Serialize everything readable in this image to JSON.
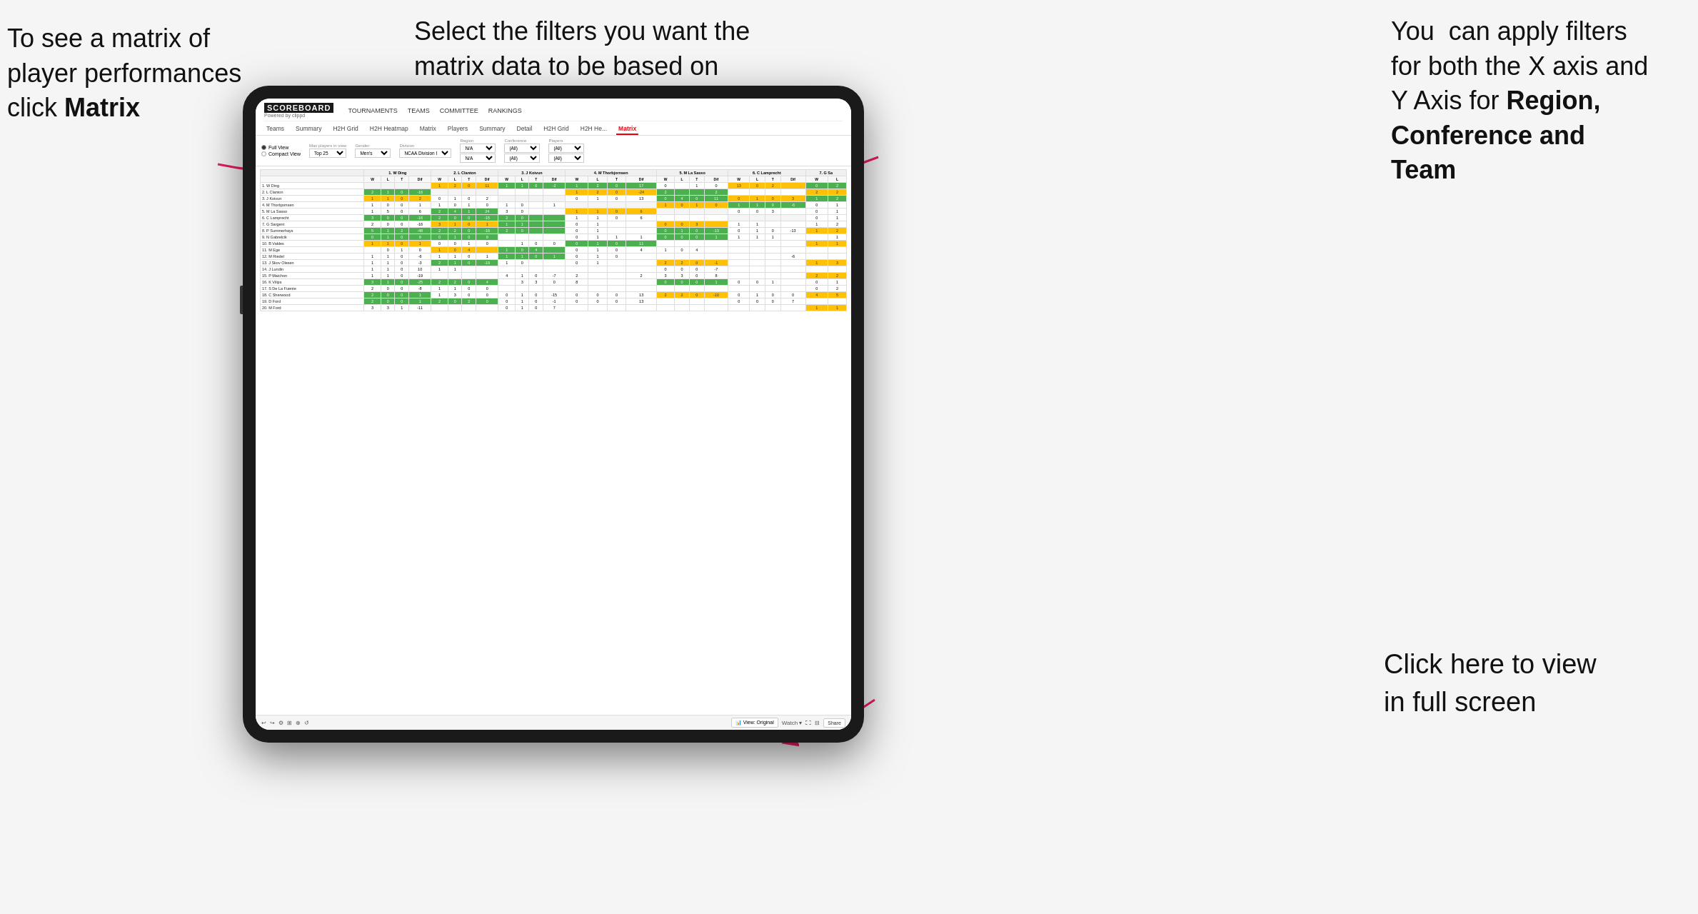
{
  "annotations": {
    "topleft": {
      "line1": "To see a matrix of",
      "line2": "player performances",
      "line3": "click ",
      "bold": "Matrix"
    },
    "topmid": {
      "text": "Select the filters you want the matrix data to be based on"
    },
    "topright": {
      "line1": "You  can apply filters for both the X axis and Y Axis for ",
      "bold1": "Region,",
      "line2": " ",
      "bold2": "Conference and",
      "line3": " ",
      "bold3": "Team"
    },
    "bottomright": {
      "text": "Click here to view in full screen"
    }
  },
  "nav": {
    "logo": "SCOREBOARD",
    "logo_sub": "Powered by clippd",
    "top_items": [
      "TOURNAMENTS",
      "TEAMS",
      "COMMITTEE",
      "RANKINGS"
    ],
    "sub_items": [
      "Teams",
      "Summary",
      "H2H Grid",
      "H2H Heatmap",
      "Matrix",
      "Players",
      "Summary",
      "Detail",
      "H2H Grid",
      "H2H He...",
      "Matrix"
    ]
  },
  "controls": {
    "view_options": [
      "Full View",
      "Compact View"
    ],
    "filters": {
      "max_players": {
        "label": "Max players in view",
        "value": "Top 25"
      },
      "gender": {
        "label": "Gender",
        "value": "Men's"
      },
      "division": {
        "label": "Division",
        "value": "NCAA Division I"
      },
      "region": {
        "label": "Region",
        "value": "N/A",
        "value2": "N/A"
      },
      "conference": {
        "label": "Conference",
        "value": "(All)",
        "value2": "(All)"
      },
      "players": {
        "label": "Players",
        "value": "(All)",
        "value2": "(All)"
      }
    }
  },
  "matrix": {
    "col_headers": [
      "1. W Ding",
      "2. L Clanton",
      "3. J Koivun",
      "4. M Thorbjornsen",
      "5. M La Sasso",
      "6. C Lamprecht",
      "7. G Sa"
    ],
    "sub_cols": [
      "W",
      "L",
      "T",
      "Dif"
    ],
    "rows": [
      {
        "name": "1. W Ding",
        "cells": "empty-first"
      },
      {
        "name": "2. L Clanton"
      },
      {
        "name": "3. J Koivun"
      },
      {
        "name": "4. M Thorbjornsen"
      },
      {
        "name": "5. M La Sasso"
      },
      {
        "name": "6. C Lamprecht"
      },
      {
        "name": "7. G Sargent"
      },
      {
        "name": "8. P Summerhays"
      },
      {
        "name": "9. N Gabrelcik"
      },
      {
        "name": "10. B Valdes"
      },
      {
        "name": "11. M Ege"
      },
      {
        "name": "12. M Riedel"
      },
      {
        "name": "13. J Skov Olesen"
      },
      {
        "name": "14. J Lundin"
      },
      {
        "name": "15. P Maichon"
      },
      {
        "name": "16. K Vilips"
      },
      {
        "name": "17. S De La Fuente"
      },
      {
        "name": "18. C Sherwood"
      },
      {
        "name": "19. D Ford"
      },
      {
        "name": "20. M Ford"
      }
    ]
  },
  "toolbar": {
    "view_original": "View: Original",
    "watch": "Watch ▾",
    "share": "Share"
  }
}
